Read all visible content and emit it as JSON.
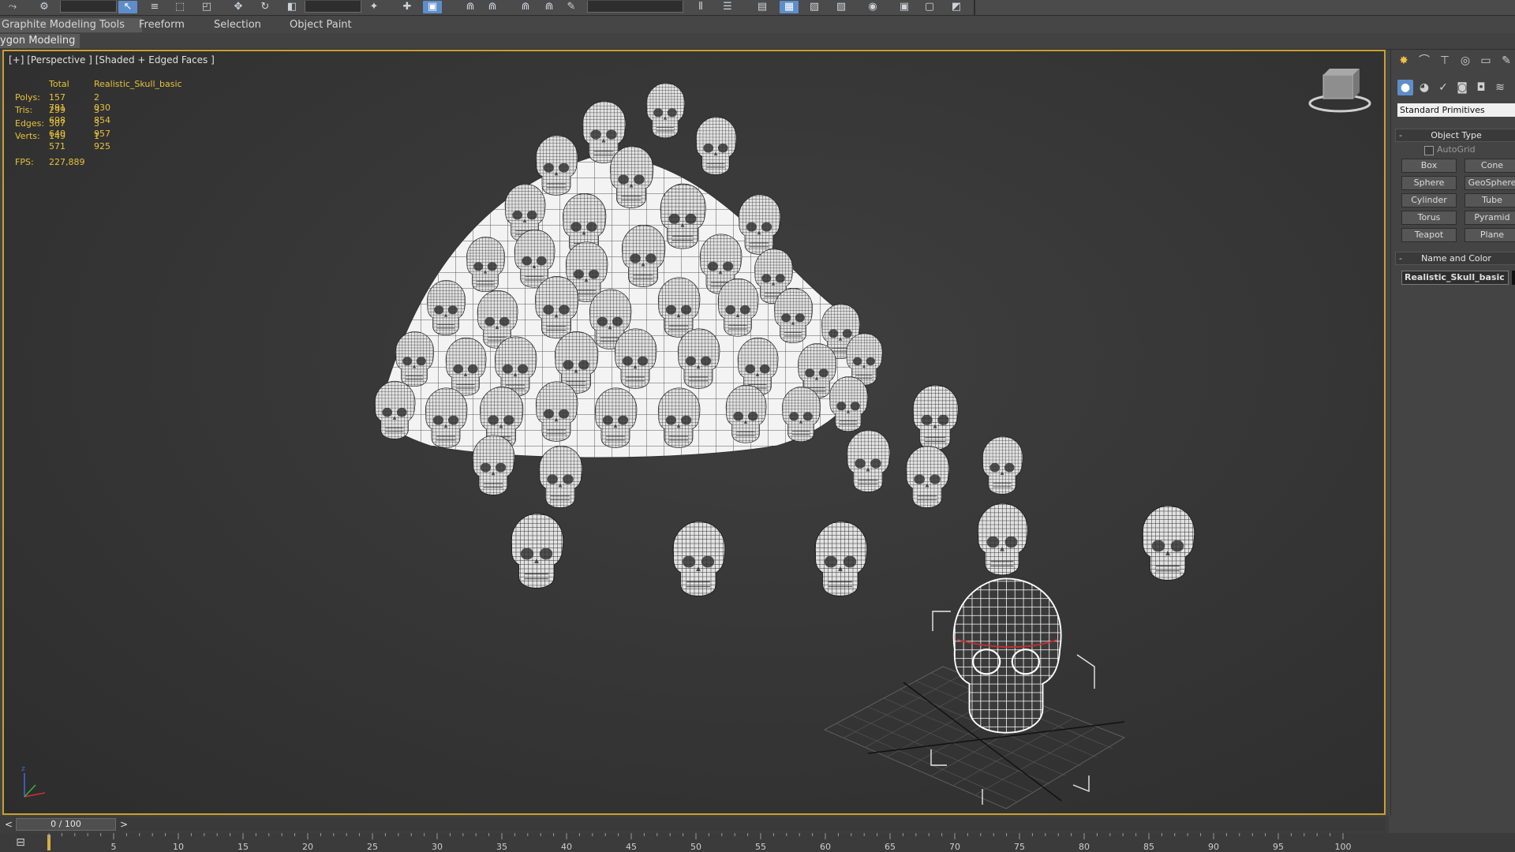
{
  "ribbon": {
    "tabs": [
      "Graphite Modeling Tools",
      "Freeform",
      "Selection",
      "Object Paint"
    ],
    "active_tab": "Graphite Modeling Tools",
    "panel_tab": "ygon Modeling"
  },
  "viewport": {
    "label": "[+] [Perspective ] [Shaded + Edged Faces ]",
    "stats": {
      "header_total": "Total",
      "header_object": "Realistic_Skull_basic",
      "rows": [
        {
          "label": "Polys:",
          "total": "157 791",
          "object": "2 030"
        },
        {
          "label": "Tris:",
          "total": "299 698",
          "object": "3 854"
        },
        {
          "label": "Edges:",
          "total": "307 640",
          "object": "3 957"
        },
        {
          "label": "Verts:",
          "total": "149 571",
          "object": "1 925"
        }
      ],
      "fps_label": "FPS:",
      "fps_value": "227,889"
    }
  },
  "command_panel": {
    "category_dropdown": "Standard Primitives",
    "object_type": {
      "title": "Object Type",
      "autogrid_label": "AutoGrid",
      "buttons": [
        "Box",
        "Cone",
        "Sphere",
        "GeoSphere",
        "Cylinder",
        "Tube",
        "Torus",
        "Pyramid",
        "Teapot",
        "Plane"
      ]
    },
    "name_and_color": {
      "title": "Name and Color",
      "name": "Realistic_Skull_basic",
      "color": "#111111"
    }
  },
  "time_slider": {
    "frame_label": "0 / 100",
    "prev": "<",
    "next": ">",
    "ticks": [
      5,
      10,
      15,
      20,
      25,
      30,
      35,
      40,
      45,
      50,
      55,
      60,
      65,
      70,
      75,
      80,
      85,
      90,
      95,
      100
    ]
  },
  "colors": {
    "viewport_border": "#c8a030",
    "stats_text": "#e8c23b",
    "selection": "#5d8ec9"
  }
}
